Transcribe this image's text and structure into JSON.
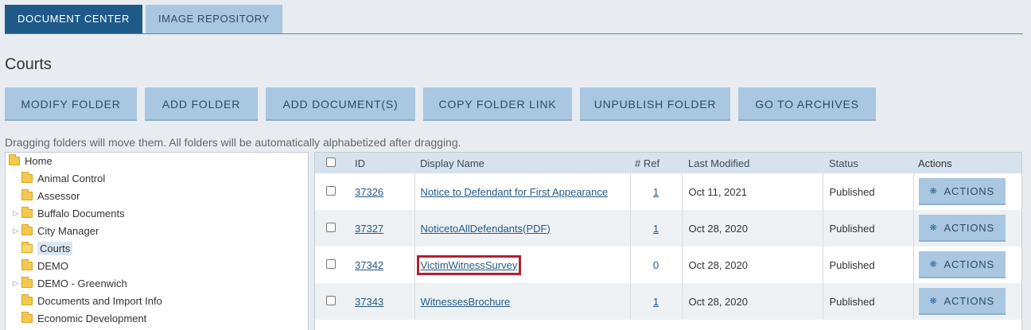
{
  "tabs": [
    {
      "label": "DOCUMENT CENTER",
      "active": true
    },
    {
      "label": "IMAGE REPOSITORY",
      "active": false
    }
  ],
  "page": {
    "title": "Courts",
    "hint": "Dragging folders will move them. All folders will be automatically alphabetized after dragging."
  },
  "toolbar": {
    "modify_folder": "MODIFY FOLDER",
    "add_folder": "ADD FOLDER",
    "add_documents": "ADD DOCUMENT(S)",
    "copy_folder_link": "COPY FOLDER LINK",
    "unpublish_folder": "UNPUBLISH FOLDER",
    "go_to_archives": "GO TO ARCHIVES"
  },
  "tree": {
    "items": [
      {
        "label": "Home",
        "expandable": false
      },
      {
        "label": "Animal Control",
        "expandable": false
      },
      {
        "label": "Assessor",
        "expandable": false
      },
      {
        "label": "Buffalo Documents",
        "expandable": true
      },
      {
        "label": "City Manager",
        "expandable": true
      },
      {
        "label": "Courts",
        "expandable": false,
        "selected": true
      },
      {
        "label": "DEMO",
        "expandable": false
      },
      {
        "label": "DEMO - Greenwich",
        "expandable": true
      },
      {
        "label": "Documents and Import Info",
        "expandable": false
      },
      {
        "label": "Economic Development",
        "expandable": false
      }
    ]
  },
  "table": {
    "headers": {
      "id": "ID",
      "display_name": "Display Name",
      "ref": "# Ref",
      "last_modified": "Last Modified",
      "status": "Status",
      "actions": "Actions"
    },
    "rows": [
      {
        "id": "37326",
        "name": "Notice to Defendant for First Appearance",
        "ref": "1",
        "ref_link": true,
        "modified": "Oct 11, 2021",
        "status": "Published",
        "action": "ACTIONS"
      },
      {
        "id": "37327",
        "name": "NoticetoAllDefendants(PDF)",
        "ref": "1",
        "ref_link": true,
        "modified": "Oct 28, 2020",
        "status": "Published",
        "action": "ACTIONS"
      },
      {
        "id": "37342",
        "name": "VictimWitnessSurvey",
        "ref": "0",
        "ref_link": false,
        "modified": "Oct 28, 2020",
        "status": "Published",
        "action": "ACTIONS",
        "highlighted": true
      },
      {
        "id": "37343",
        "name": "WitnessesBrochure",
        "ref": "1",
        "ref_link": true,
        "modified": "Oct 28, 2020",
        "status": "Published",
        "action": "ACTIONS"
      }
    ]
  },
  "icons": {
    "folder": "folder-icon",
    "caret": "caret-right-icon",
    "gear": "gear-icon"
  },
  "colors": {
    "accent": "#1e5a87",
    "button": "#a9c7e1",
    "highlight": "#b4202f",
    "link": "#245a86"
  }
}
